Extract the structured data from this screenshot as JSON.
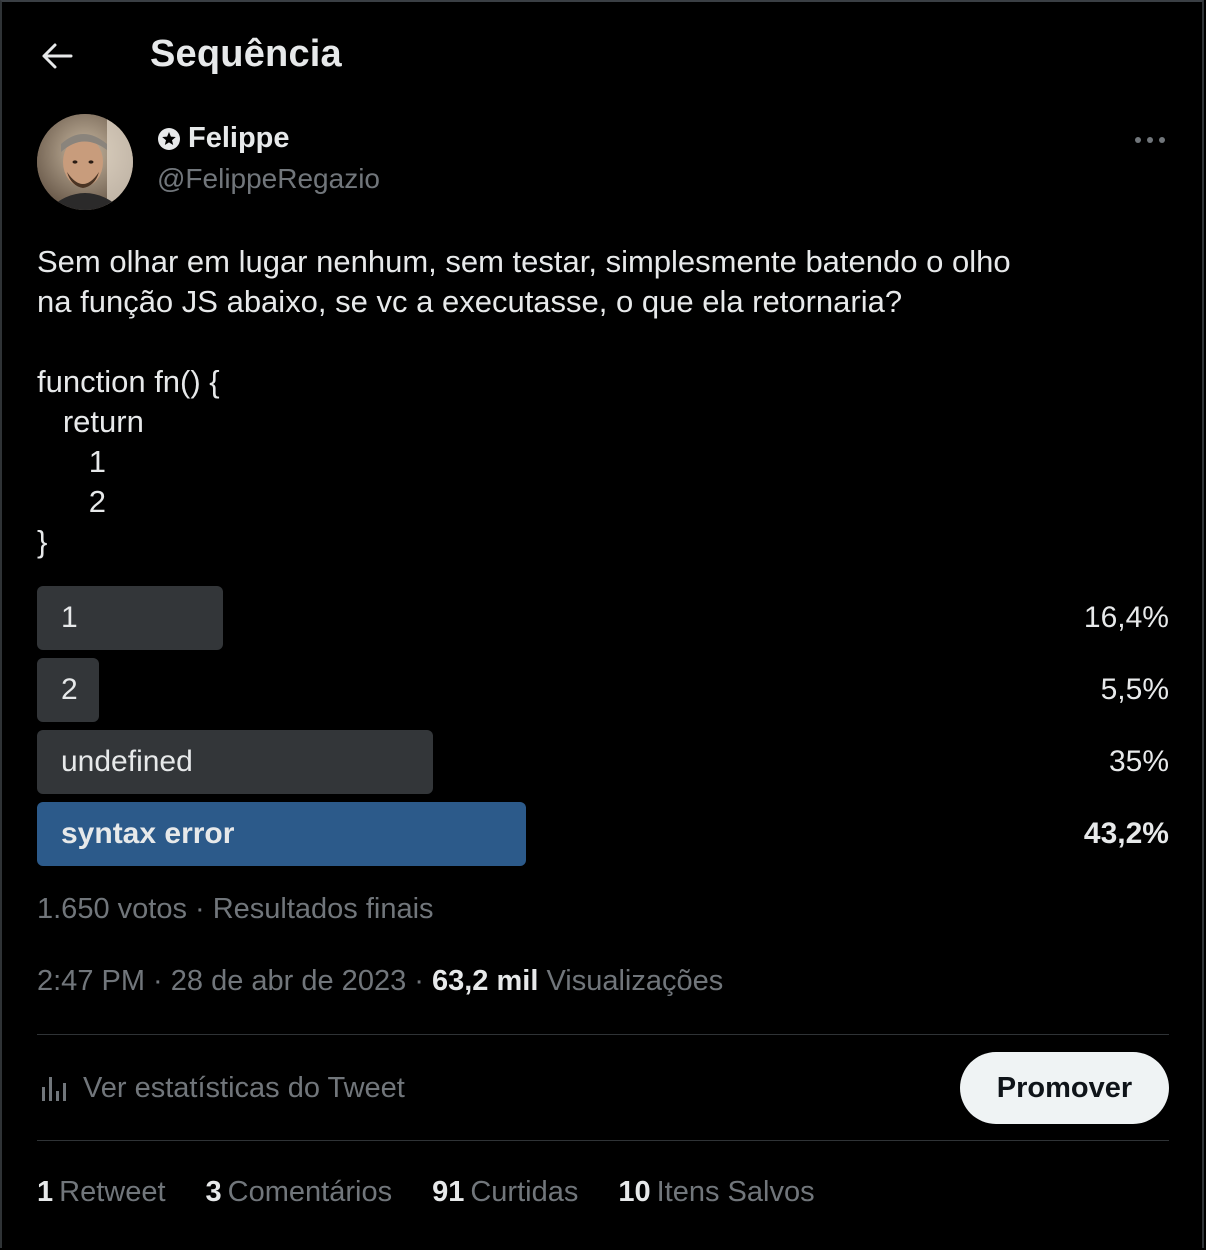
{
  "header": {
    "title": "Sequência"
  },
  "author": {
    "name": "Felippe",
    "handle": "@FelippeRegazio"
  },
  "tweet": {
    "text": "Sem olhar em lugar nenhum, sem testar, simplesmente batendo o olho\nna função JS abaixo, se vc a executasse, o que ela retornaria?\n\nfunction fn() {\n   return\n      1\n      2\n}"
  },
  "poll": {
    "options": [
      {
        "label": "1",
        "percent_text": "16,4%",
        "percent": 16.4
      },
      {
        "label": "2",
        "percent_text": "5,5%",
        "percent": 5.5
      },
      {
        "label": "undefined",
        "percent_text": "35%",
        "percent": 35
      },
      {
        "label": "syntax error",
        "percent_text": "43,2%",
        "percent": 43.2
      }
    ],
    "meta": "1.650 votos · Resultados finais",
    "winner_color": "#2c5a8a",
    "bar_color": "#333639"
  },
  "timestamp": {
    "time_date": "2:47 PM · 28 de abr de 2023 · ",
    "views_count": "63,2 mil",
    "views_label": " Visualizações"
  },
  "actions": {
    "stats_label": "Ver estatísticas do Tweet",
    "promote_label": "Promover"
  },
  "counts": {
    "retweets": {
      "num": "1",
      "label": "Retweet"
    },
    "comments": {
      "num": "3",
      "label": "Comentários"
    },
    "likes": {
      "num": "91",
      "label": "Curtidas"
    },
    "saves": {
      "num": "10",
      "label": "Itens Salvos"
    }
  },
  "icons": {
    "back": "arrow-left-icon",
    "badge": "verified-star-icon",
    "more": "more-horizontal-icon",
    "stats": "bar-chart-icon"
  }
}
